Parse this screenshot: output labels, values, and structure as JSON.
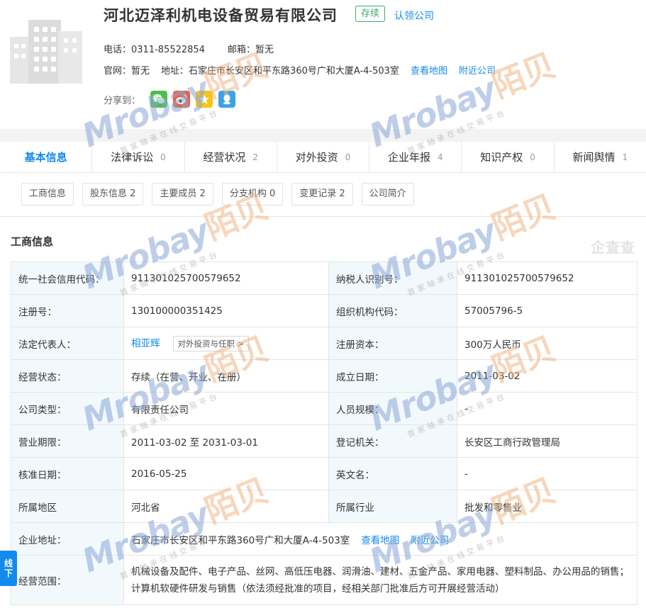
{
  "company": {
    "name": "河北迈泽利机电设备贸易有限公司",
    "status": "存续",
    "claim": "认领公司",
    "phone_label": "电话：",
    "phone": "0311-85522854",
    "email_label": "邮箱：",
    "email": "暂无",
    "site_label": "官网：",
    "site": "暂无",
    "addr_label": "地址：",
    "addr": "石家庄市长安区和平东路360号广和大厦A-4-503室",
    "map_link": "查看地图",
    "nearby_link": "附近公司",
    "share_label": "分享到："
  },
  "tabs": [
    {
      "label": "基本信息",
      "count": ""
    },
    {
      "label": "法律诉讼",
      "count": "0"
    },
    {
      "label": "经营状况",
      "count": "2"
    },
    {
      "label": "对外投资",
      "count": "0"
    },
    {
      "label": "企业年报",
      "count": "4"
    },
    {
      "label": "知识产权",
      "count": "0"
    },
    {
      "label": "新闻舆情",
      "count": "1"
    }
  ],
  "subtabs": [
    "工商信息",
    "股东信息 2",
    "主要成员 2",
    "分支机构 0",
    "变更记录 2",
    "公司简介"
  ],
  "section": {
    "title": "工商信息",
    "brand": "企查查"
  },
  "table": {
    "credit_code_k": "统一社会信用代码：",
    "credit_code_v": "911301025700579652",
    "taxpayer_k": "纳税人识别号：",
    "taxpayer_v": "911301025700579652",
    "reg_no_k": "注册号：",
    "reg_no_v": "130100000351425",
    "org_code_k": "组织机构代码：",
    "org_code_v": "57005796-5",
    "legal_rep_k": "法定代表人：",
    "legal_rep_v": "相亚辉",
    "legal_rep_btn": "对外投资与任职 >",
    "capital_k": "注册资本：",
    "capital_v": "300万人民币",
    "biz_status_k": "经营状态：",
    "biz_status_v": "存续（在营、开业、在册）",
    "found_date_k": "成立日期：",
    "found_date_v": "2011-03-02",
    "type_k": "公司类型：",
    "type_v": "有限责任公司",
    "staff_k": "人员规模：",
    "staff_v": "-",
    "term_k": "营业期限：",
    "term_v": "2011-03-02 至 2031-03-01",
    "authority_k": "登记机关：",
    "authority_v": "长安区工商行政管理局",
    "approve_k": "核准日期：",
    "approve_v": "2016-05-25",
    "en_name_k": "英文名：",
    "en_name_v": "-",
    "region_k": "所属地区",
    "region_v": "河北省",
    "industry_k": "所属行业",
    "industry_v": "批发和零售业",
    "address_k": "企业地址：",
    "address_v": "石家庄市长安区和平东路360号广和大厦A-4-503室",
    "address_map": "查看地图",
    "address_nearby": "附近公司",
    "scope_k": "经营范围：",
    "scope_v": "机械设备及配件、电子产品、丝网、高低压电器、润滑油、建材、五金产品、家用电器、塑料制品、办公用品的销售；计算机软硬件研发与销售（依法须经批准的项目，经相关部门批准后方可开展经营活动）"
  },
  "side_tab": {
    "line1": "线",
    "line2": "下"
  },
  "watermark": {
    "brand": "Mrobay",
    "brand_cn": "陌贝",
    "slogan": "首家轴承在线交易平台"
  }
}
